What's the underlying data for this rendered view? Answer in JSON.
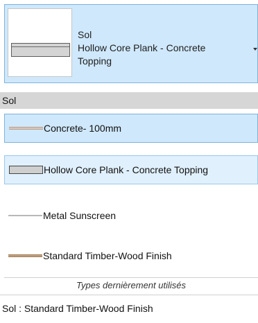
{
  "selected_type": {
    "family": "Sol",
    "name_line_1": "Hollow Core Plank - Concrete",
    "name_line_2": "Topping",
    "preview_icon": "floor-section-preview-icon"
  },
  "category": {
    "label": "Sol"
  },
  "types": [
    {
      "label": "Concrete- 100mm",
      "icon": "concrete-swatch-icon",
      "state": "selected"
    },
    {
      "label": "Hollow Core Plank - Concrete Topping",
      "icon": "hollow-core-swatch-icon",
      "state": "hover"
    },
    {
      "label": "Metal Sunscreen",
      "icon": "metal-swatch-icon",
      "state": "normal"
    },
    {
      "label": "Standard Timber-Wood Finish",
      "icon": "timber-swatch-icon",
      "state": "normal"
    }
  ],
  "recent": {
    "header": "Types dernièrement utilisés",
    "items": [
      {
        "label": "Sol : Standard Timber-Wood Finish"
      }
    ]
  },
  "colors": {
    "selection_fill": "#cfe8fb",
    "selection_border": "#7fb2db",
    "category_fill": "#d6d6d6"
  }
}
